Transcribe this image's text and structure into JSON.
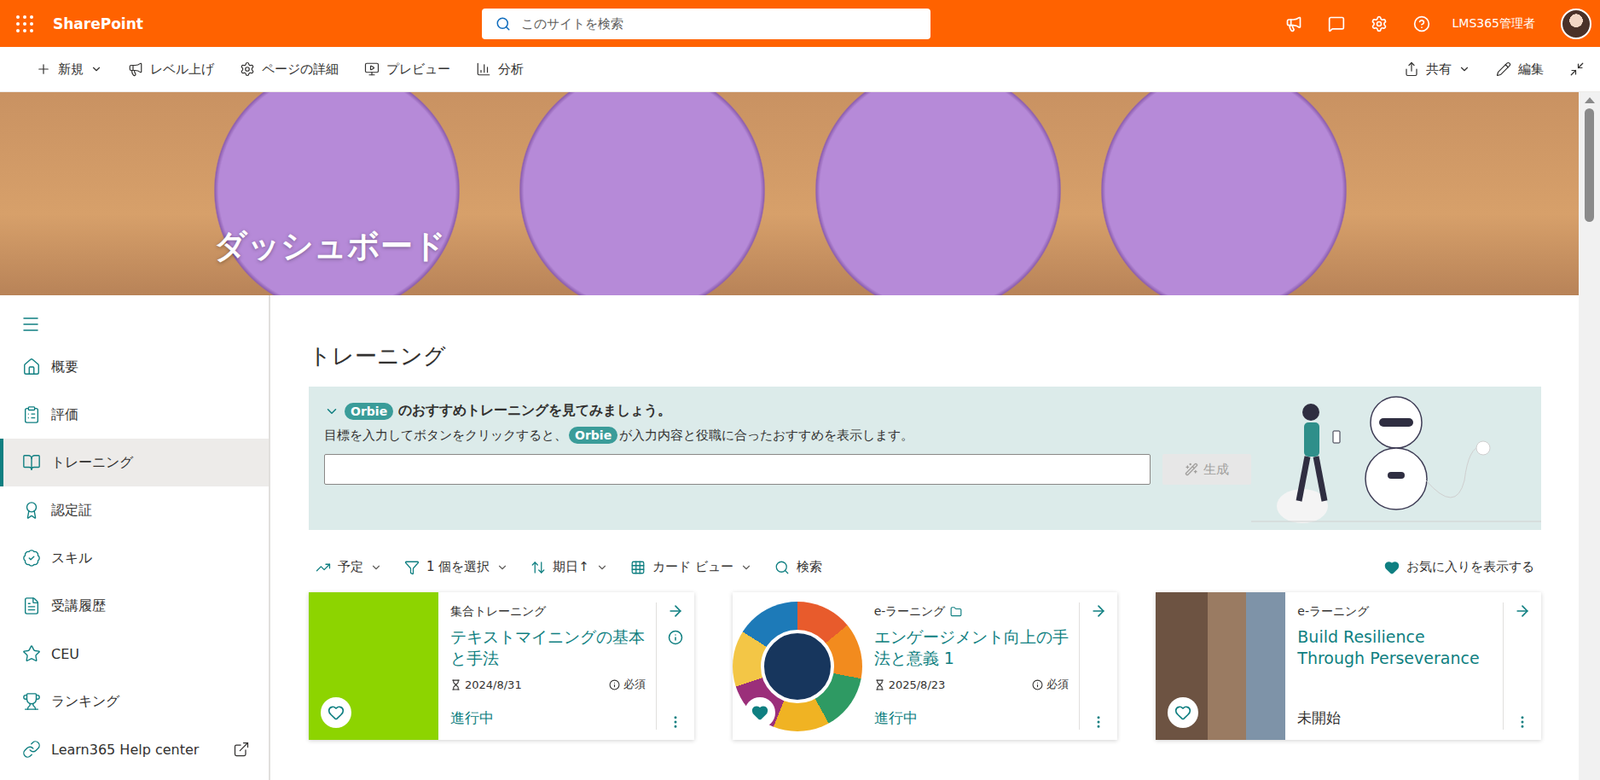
{
  "topbar": {
    "brand": "SharePoint",
    "search_placeholder": "このサイトを検索",
    "user": "LMS365管理者"
  },
  "commandbar": {
    "left": [
      {
        "label": "新規",
        "menu": true
      },
      {
        "label": "レベル上げ",
        "menu": false
      },
      {
        "label": "ページの詳細",
        "menu": false
      },
      {
        "label": "プレビュー",
        "menu": false
      },
      {
        "label": "分析",
        "menu": false
      }
    ],
    "right": [
      {
        "label": "共有",
        "menu": true
      },
      {
        "label": "編集",
        "menu": false
      }
    ]
  },
  "banner": {
    "title": "ダッシュボード"
  },
  "sidebar": {
    "items": [
      {
        "label": "概要",
        "selected": false,
        "external": false
      },
      {
        "label": "評価",
        "selected": false,
        "external": false
      },
      {
        "label": "トレーニング",
        "selected": true,
        "external": false
      },
      {
        "label": "認定証",
        "selected": false,
        "external": false
      },
      {
        "label": "スキル",
        "selected": false,
        "external": false
      },
      {
        "label": "受講履歴",
        "selected": false,
        "external": false
      },
      {
        "label": "CEU",
        "selected": false,
        "external": false
      },
      {
        "label": "ランキング",
        "selected": false,
        "external": false
      },
      {
        "label": "Learn365 Help center",
        "selected": false,
        "external": true
      }
    ]
  },
  "heading": "トレーニング",
  "orbie": {
    "expanded": true,
    "badge": "Orbie",
    "title_suffix": "のおすすめトレーニングを見てみましょう。",
    "desc_before": "目標を入力してボタンをクリックすると、",
    "desc_after": "が入力内容と役職に合ったおすすめを表示します。",
    "input_value": "",
    "button": {
      "label": "生成",
      "disabled": true
    }
  },
  "filters": [
    {
      "label": "予定",
      "menu": true
    },
    {
      "label": "1 個を選択",
      "menu": true
    },
    {
      "label": "期日↑",
      "menu": true
    },
    {
      "label": "カード ビュー",
      "menu": true
    },
    {
      "label": "検索",
      "menu": false
    }
  ],
  "favorites_toggle": {
    "label": "お気に入りを表示する"
  },
  "cards": [
    {
      "type": "集合トレーニング",
      "catalog_icon": false,
      "title": "テキストマイニングの基本と手法",
      "due": "2024/8/31",
      "required": "必須",
      "status": "進行中",
      "started": true,
      "favorite": false,
      "has_info": true,
      "image_kind": "illustration",
      "color": "#8dd400"
    },
    {
      "type": "e-ラーニング",
      "catalog_icon": true,
      "title": "エンゲージメント向上の手法と意義 1",
      "due": "2025/8/23",
      "required": "必須",
      "status": "進行中",
      "started": true,
      "favorite": true,
      "has_info": false,
      "image_kind": "diagram",
      "color": "#ffffff"
    },
    {
      "type": "e-ラーニング",
      "catalog_icon": false,
      "title": "Build Resilience Through Perseverance",
      "status": "未開始",
      "started": false,
      "favorite": false,
      "has_info": false,
      "image_kind": "photo",
      "color": "#9a7b62"
    }
  ],
  "scrollbar": {
    "position": 0,
    "visible_share": 0.17
  }
}
